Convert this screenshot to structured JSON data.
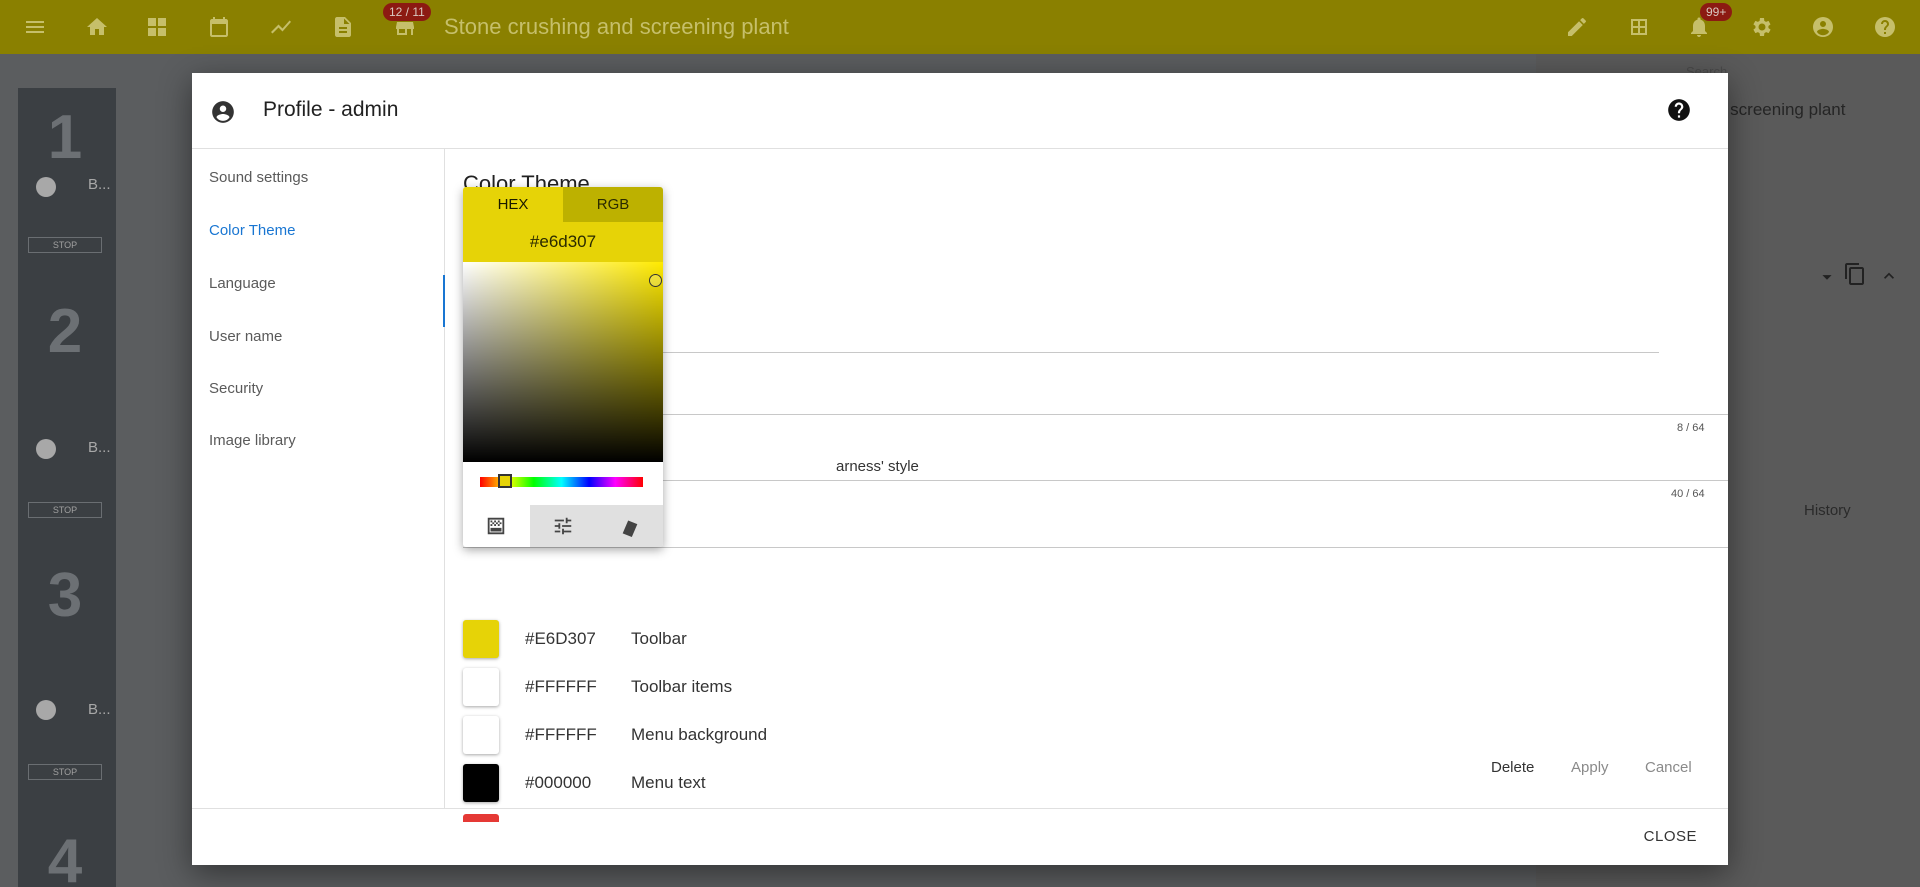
{
  "app": {
    "title": "Stone crushing and screening plant",
    "page_badge": "12 / 11",
    "notifications_badge": "99+",
    "right_panel_text": "d screening plant",
    "right_panel_history": "History",
    "right_panel_search_placeholder": "Search",
    "bg_numbers": [
      "1",
      "2",
      "3",
      "4"
    ],
    "bg_label_b": "B...",
    "bg_stop": "STOP"
  },
  "dialog": {
    "title": "Profile - admin",
    "nav_items": [
      "Sound settings",
      "Color Theme",
      "Language",
      "User name",
      "Security",
      "Image library"
    ],
    "active_nav": "Color Theme",
    "section_title": "Color Theme",
    "field_counters": [
      "8 / 64",
      "40 / 64"
    ],
    "visible_fragment": "arness' style",
    "colors": [
      {
        "hex": "#E6D307",
        "label": "Toolbar",
        "swatch": "#e6d307"
      },
      {
        "hex": "#FFFFFF",
        "label": "Toolbar items",
        "swatch": "#ffffff"
      },
      {
        "hex": "#FFFFFF",
        "label": "Menu background",
        "swatch": "#ffffff"
      },
      {
        "hex": "#000000",
        "label": "Menu text",
        "swatch": "#000000"
      }
    ],
    "next_swatch_color": "#e53935",
    "actions": {
      "delete": "Delete",
      "apply": "Apply",
      "cancel": "Cancel"
    },
    "close": "CLOSE"
  },
  "picker": {
    "tabs": [
      "HEX",
      "RGB"
    ],
    "active_tab": "HEX",
    "value": "#e6d307",
    "modes": [
      "palette-icon",
      "sliders-icon",
      "swatches-icon"
    ],
    "active_mode": "palette-icon"
  },
  "colors": {
    "toolbar_dimmed": "#8a8000",
    "accent": "#1976d2",
    "picked": "#e6d307"
  }
}
